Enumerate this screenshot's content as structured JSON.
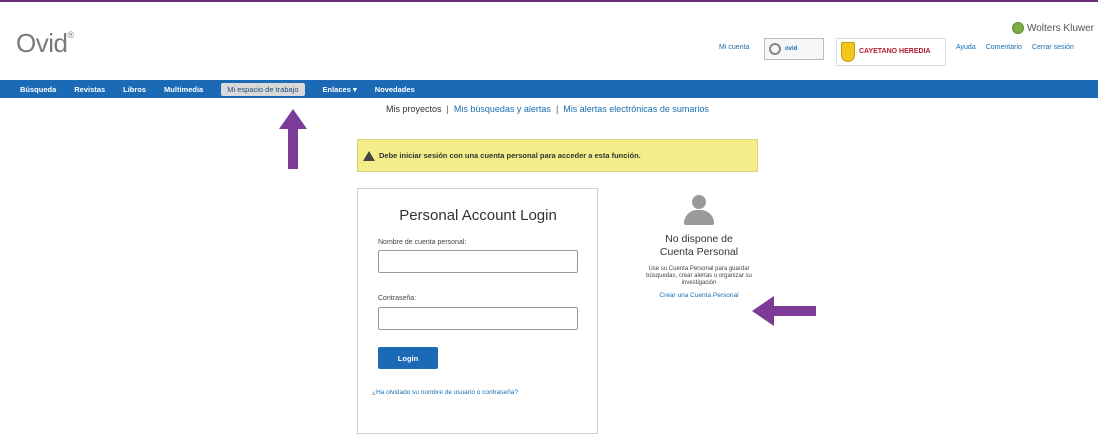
{
  "header": {
    "logo": "Ovid",
    "logo_mark": "®",
    "brand": "Wolters Kluwer",
    "mi_cuenta": "Mi cuenta",
    "ovid_badge": "ovid",
    "institution": "CAYETANO HEREDIA",
    "links": [
      "Ayuda",
      "Comentario",
      "Cerrar sesión"
    ]
  },
  "nav": {
    "items": [
      "Búsqueda",
      "Revistas",
      "Libros",
      "Multimedia",
      "Mi espacio de trabajo",
      "Enlaces ▾",
      "Novedades"
    ],
    "active_index": 4
  },
  "subnav": {
    "current": "Mis proyectos",
    "separator": "|",
    "links": [
      "Mis búsquedas y alertas",
      "Mis alertas electrónicas de sumarios"
    ]
  },
  "warning": {
    "text": "Debe iniciar sesión con una cuenta personal para acceder a esta función."
  },
  "login": {
    "title": "Personal Account Login",
    "username_label": "Nombre de cuenta personal:",
    "username_value": "",
    "password_label": "Contraseña:",
    "password_value": "",
    "button": "Login",
    "forgot": "¿Ha olvidado su nombre de usuario o contraseña?"
  },
  "no_account": {
    "title_line1": "No dispone de",
    "title_line2": "Cuenta Personal",
    "description": "Use su Cuenta Personal para guardar búsquedas, crear alertas u organizar su investigación",
    "link": "Crear una Cuenta Personal"
  },
  "colors": {
    "nav_bg": "#1c6ab5",
    "warning_bg": "#f4ee8a",
    "annotation_arrow": "#7b3b96",
    "link": "#1a6fb0"
  }
}
